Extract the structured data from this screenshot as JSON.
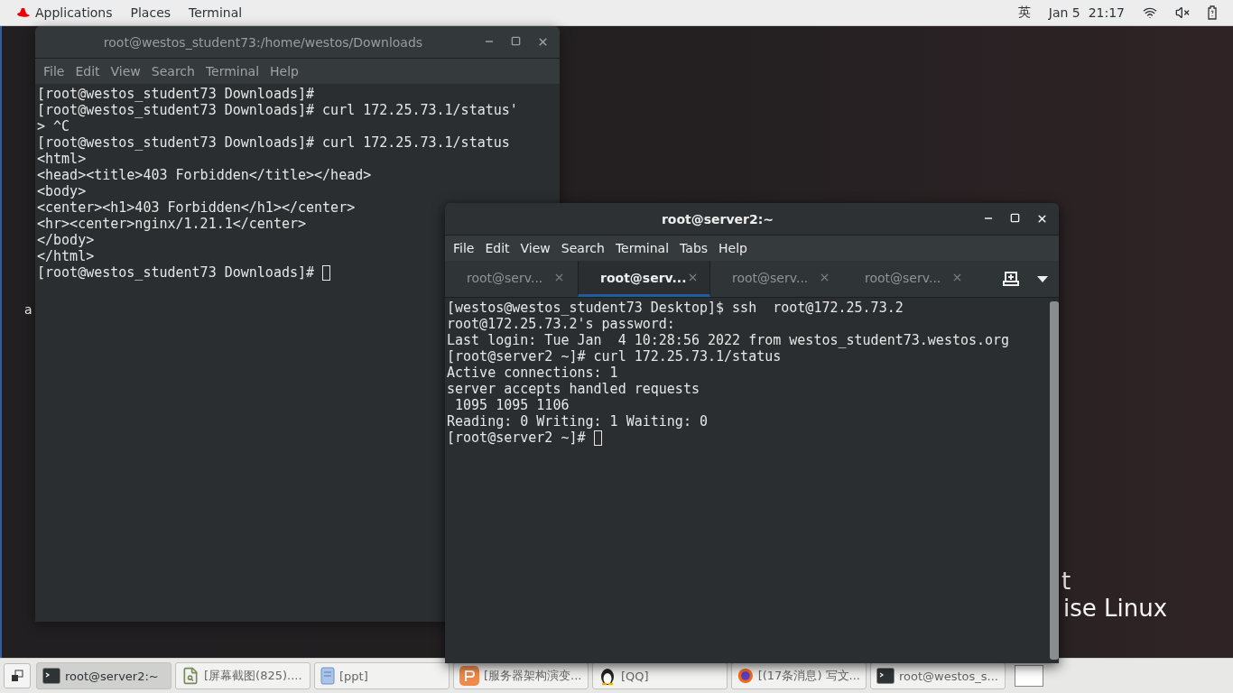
{
  "top_bar": {
    "menus": [
      "Applications",
      "Places",
      "Terminal"
    ],
    "input_method": "英",
    "clock": "Jan 5  21:17"
  },
  "desktop_texts": [
    "a",
    "t",
    "ise Linux"
  ],
  "windows": [
    {
      "title": "root@westos_student73:/home/westos/Downloads",
      "focused": false,
      "menu": [
        "File",
        "Edit",
        "View",
        "Search",
        "Terminal",
        "Help"
      ],
      "lines": [
        "[root@westos_student73 Downloads]#",
        "[root@westos_student73 Downloads]# curl 172.25.73.1/status'",
        "> ^C",
        "[root@westos_student73 Downloads]# curl 172.25.73.1/status",
        "<html>",
        "<head><title>403 Forbidden</title></head>",
        "<body>",
        "<center><h1>403 Forbidden</h1></center>",
        "<hr><center>nginx/1.21.1</center>",
        "</body>",
        "</html>",
        "[root@westos_student73 Downloads]# "
      ]
    },
    {
      "title": "root@server2:~",
      "focused": true,
      "menu": [
        "File",
        "Edit",
        "View",
        "Search",
        "Terminal",
        "Tabs",
        "Help"
      ],
      "tabs": [
        {
          "label": "root@serv...",
          "selected": false
        },
        {
          "label": "root@serv...",
          "selected": true
        },
        {
          "label": "root@serv...",
          "selected": false
        },
        {
          "label": "root@serv...",
          "selected": false
        }
      ],
      "lines": [
        "[westos@westos_student73 Desktop]$ ssh  root@172.25.73.2",
        "root@172.25.73.2's password:",
        "Last login: Tue Jan  4 10:28:56 2022 from westos_student73.westos.org",
        "[root@server2 ~]# curl 172.25.73.1/status",
        "Active connections: 1",
        "server accepts handled requests",
        " 1095 1095 1106",
        "Reading: 0 Writing: 1 Waiting: 0",
        "[root@server2 ~]# "
      ]
    }
  ],
  "taskbar": [
    {
      "kind": "terminal",
      "label": "root@server2:~",
      "selected": true
    },
    {
      "kind": "image",
      "label": "[屏幕截图(825)....",
      "selected": false
    },
    {
      "kind": "file",
      "label": "[ppt]",
      "selected": false
    },
    {
      "kind": "app",
      "label": "[服务器架构演变...",
      "selected": false
    },
    {
      "kind": "penguin",
      "label": "[QQ]",
      "selected": false
    },
    {
      "kind": "browser",
      "label": "[(17条消息) 写文...",
      "selected": false
    },
    {
      "kind": "terminal",
      "label": "root@westos_s...",
      "selected": false
    }
  ]
}
